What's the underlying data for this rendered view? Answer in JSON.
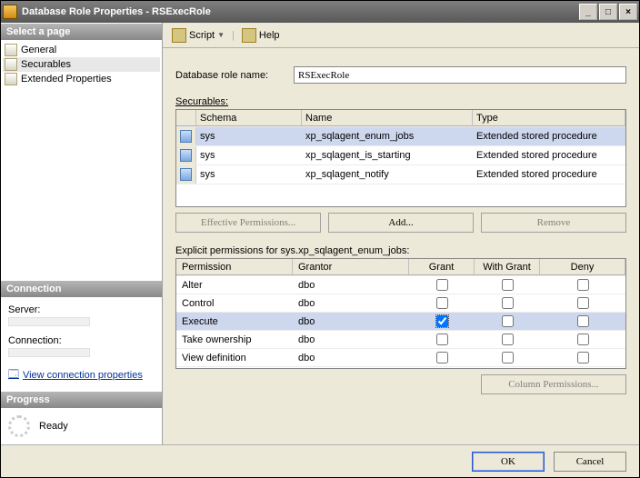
{
  "window": {
    "title": "Database Role Properties - RSExecRole",
    "minimize": "_",
    "maximize": "□",
    "close": "×"
  },
  "sidebar": {
    "select_page_hdr": "Select a page",
    "items": [
      {
        "label": "General"
      },
      {
        "label": "Securables"
      },
      {
        "label": "Extended Properties"
      }
    ],
    "connection_hdr": "Connection",
    "server_label": "Server:",
    "connection_label": "Connection:",
    "view_conn_link": "View connection properties",
    "progress_hdr": "Progress",
    "progress_status": "Ready"
  },
  "toolbar": {
    "script_label": "Script",
    "help_label": "Help"
  },
  "form": {
    "role_name_label": "Database role name:",
    "role_name_value": "RSExecRole"
  },
  "securables": {
    "label": "Securables:",
    "label_underline_char": "S",
    "headers": {
      "schema": "Schema",
      "name": "Name",
      "type": "Type"
    },
    "rows": [
      {
        "schema": "sys",
        "name": "xp_sqlagent_enum_jobs",
        "type": "Extended stored procedure",
        "selected": true
      },
      {
        "schema": "sys",
        "name": "xp_sqlagent_is_starting",
        "type": "Extended stored procedure",
        "selected": false
      },
      {
        "schema": "sys",
        "name": "xp_sqlagent_notify",
        "type": "Extended stored procedure",
        "selected": false
      }
    ]
  },
  "buttons": {
    "effective": "Effective Permissions...",
    "add": "Add...",
    "remove": "Remove"
  },
  "permissions": {
    "label": "Explicit permissions for sys.xp_sqlagent_enum_jobs:",
    "headers": {
      "permission": "Permission",
      "grantor": "Grantor",
      "grant": "Grant",
      "withgrant": "With Grant",
      "deny": "Deny"
    },
    "rows": [
      {
        "permission": "Alter",
        "grantor": "dbo",
        "grant": false,
        "withgrant": false,
        "deny": false,
        "selected": false
      },
      {
        "permission": "Control",
        "grantor": "dbo",
        "grant": false,
        "withgrant": false,
        "deny": false,
        "selected": false
      },
      {
        "permission": "Execute",
        "grantor": "dbo",
        "grant": true,
        "withgrant": false,
        "deny": false,
        "selected": true
      },
      {
        "permission": "Take ownership",
        "grantor": "dbo",
        "grant": false,
        "withgrant": false,
        "deny": false,
        "selected": false
      },
      {
        "permission": "View definition",
        "grantor": "dbo",
        "grant": false,
        "withgrant": false,
        "deny": false,
        "selected": false
      }
    ],
    "column_permissions": "Column Permissions..."
  },
  "footer": {
    "ok": "OK",
    "cancel": "Cancel"
  }
}
